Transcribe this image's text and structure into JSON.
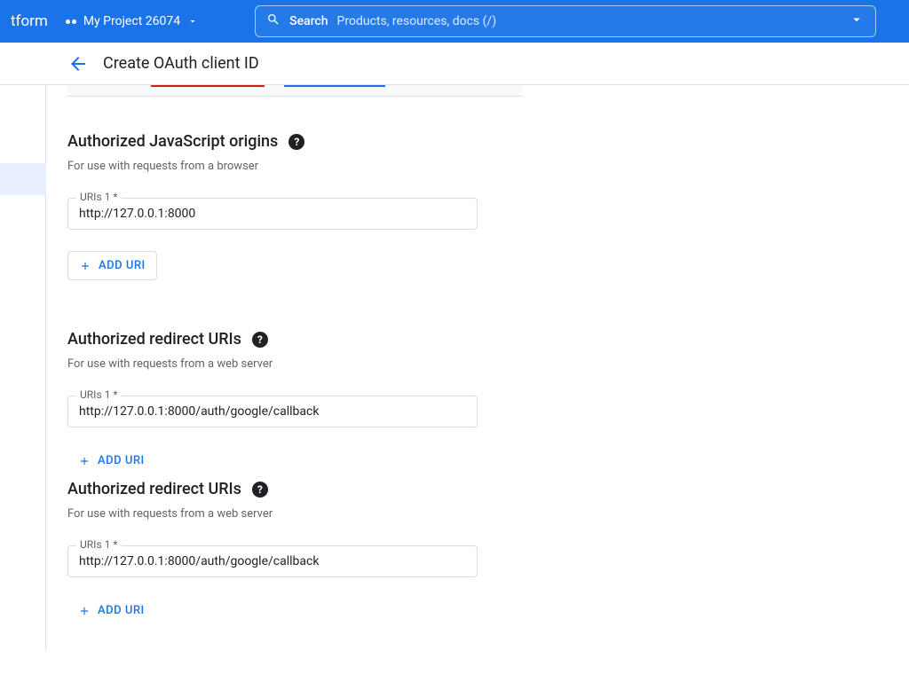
{
  "header": {
    "platform": "tform",
    "project_name": "My Project 26074",
    "search_label": "Search",
    "search_placeholder": "Products, resources, docs (/)"
  },
  "subheader": {
    "title": "Create OAuth client ID"
  },
  "sections": {
    "js_origins": {
      "title": "Authorized JavaScript origins",
      "desc": "For use with requests from a browser",
      "field_label": "URIs 1 *",
      "field_value": "http://127.0.0.1:8000",
      "add_label": "ADD URI"
    },
    "redirect1": {
      "title": "Authorized redirect URIs",
      "desc": "For use with requests from a web server",
      "field_label": "URIs 1 *",
      "field_value": "http://127.0.0.1:8000/auth/google/callback",
      "add_label": "ADD URI"
    },
    "redirect2": {
      "title": "Authorized redirect URIs",
      "desc": "For use with requests from a web server",
      "field_label": "URIs 1 *",
      "field_value": "http://127.0.0.1:8000/auth/google/callback",
      "add_label": "ADD URI"
    }
  }
}
